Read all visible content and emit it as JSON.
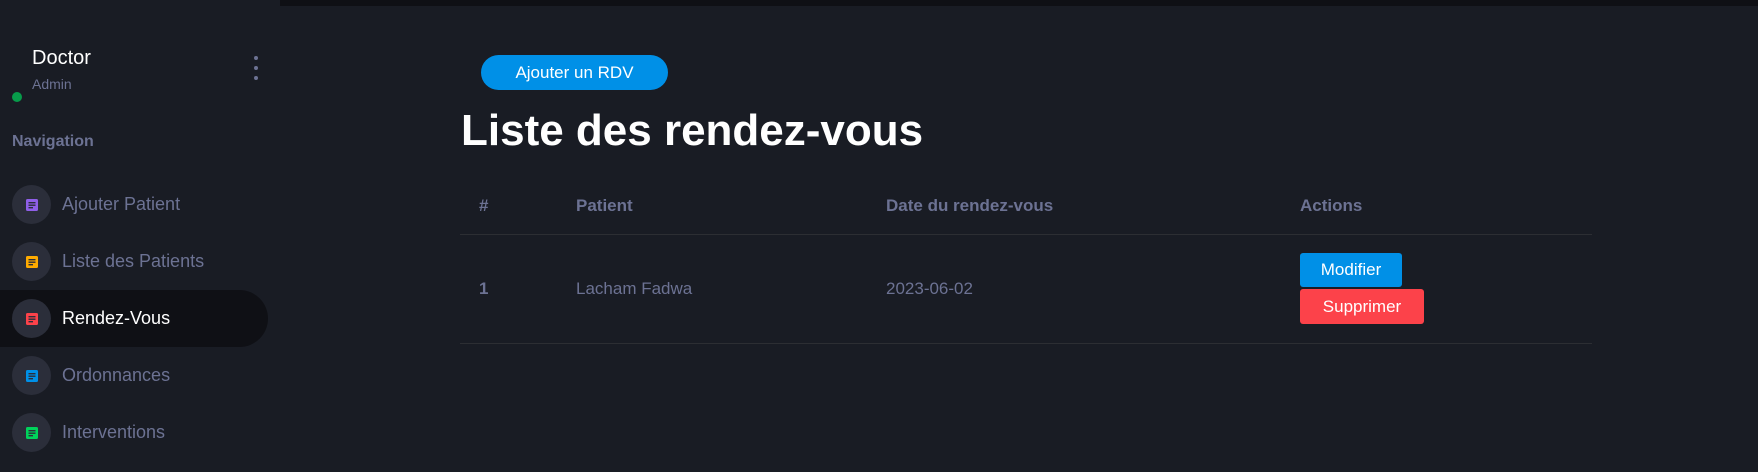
{
  "profile": {
    "name": "Doctor",
    "role": "Admin"
  },
  "sidebar": {
    "category": "Navigation",
    "items": [
      {
        "label": "Ajouter Patient",
        "icon": "document-icon",
        "color": "#8f5fe8",
        "active": false
      },
      {
        "label": "Liste des Patients",
        "icon": "document-icon",
        "color": "#ffab00",
        "active": false
      },
      {
        "label": "Rendez-Vous",
        "icon": "document-icon",
        "color": "#fc424a",
        "active": true
      },
      {
        "label": "Ordonnances",
        "icon": "document-icon",
        "color": "#0090e7",
        "active": false
      },
      {
        "label": "Interventions",
        "icon": "document-icon",
        "color": "#00d25b",
        "active": false
      }
    ]
  },
  "main": {
    "add_button": "Ajouter un RDV",
    "title": "Liste des rendez-vous",
    "table": {
      "headers": [
        "#",
        "Patient",
        "Date du rendez-vous",
        "Actions"
      ],
      "rows": [
        {
          "num": "1",
          "patient": "Lacham Fadwa",
          "date": "2023-06-02",
          "edit_label": "Modifier",
          "delete_label": "Supprimer"
        }
      ]
    }
  },
  "colors": {
    "background": "#191c24",
    "primary": "#0090e7",
    "danger": "#fc424a",
    "online": "#00d25b",
    "muted_text": "#6c7293"
  }
}
